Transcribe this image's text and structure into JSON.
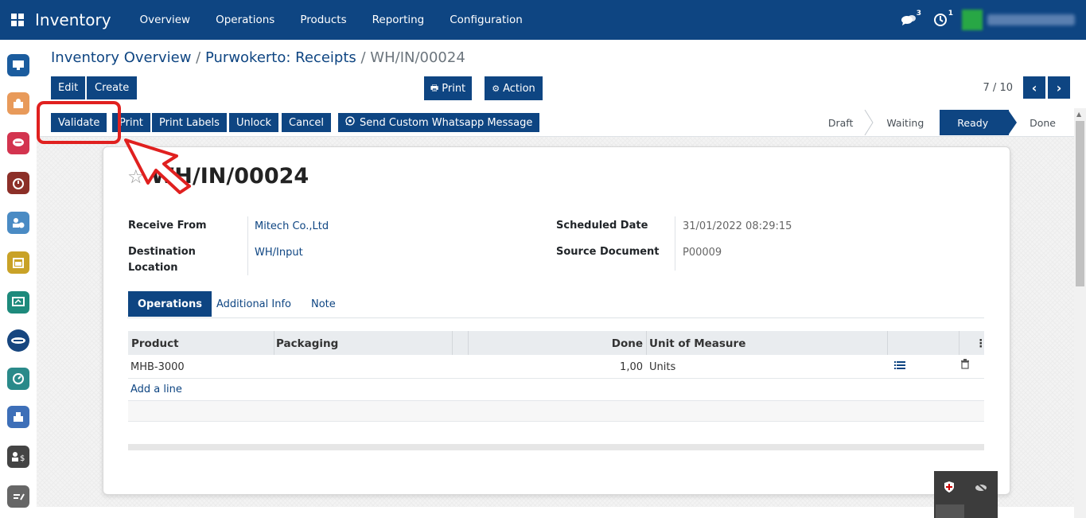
{
  "topbar": {
    "brand": "Inventory",
    "menu": [
      "Overview",
      "Operations",
      "Products",
      "Reporting",
      "Configuration"
    ],
    "messages_count": "3",
    "activities_count": "1"
  },
  "breadcrumb": {
    "part1": "Inventory Overview",
    "sep1": " / ",
    "part2": "Purwokerto: Receipts",
    "sep2": " / ",
    "current": "WH/IN/00024"
  },
  "control": {
    "edit": "Edit",
    "create": "Create",
    "print": "Print",
    "action": "Action",
    "pager": "7 / 10"
  },
  "statusbar": {
    "buttons": [
      "Validate",
      "Print",
      "Print Labels",
      "Unlock",
      "Cancel",
      "Send Custom Whatsapp Message"
    ],
    "stages": [
      "Draft",
      "Waiting",
      "Ready",
      "Done"
    ],
    "active_stage": "Ready"
  },
  "record": {
    "title": "WH/IN/00024",
    "receive_from_label": "Receive From",
    "receive_from": "Mitech Co.,Ltd",
    "destination_label_1": "Destination",
    "destination_label_2": "Location",
    "destination": "WH/Input",
    "scheduled_label": "Scheduled Date",
    "scheduled": "31/01/2022 08:29:15",
    "source_label": "Source Document",
    "source": "P00009"
  },
  "tabs": [
    "Operations",
    "Additional Info",
    "Note"
  ],
  "table": {
    "headers": [
      "Product",
      "Packaging",
      "Done",
      "Unit of Measure"
    ],
    "rows": [
      {
        "product": "MHB-3000",
        "packaging": "",
        "done": "1,00",
        "uom": "Units"
      }
    ],
    "add_line": "Add a line"
  },
  "colors": {
    "primary": "#0e4582",
    "annotation": "#e0201f"
  }
}
